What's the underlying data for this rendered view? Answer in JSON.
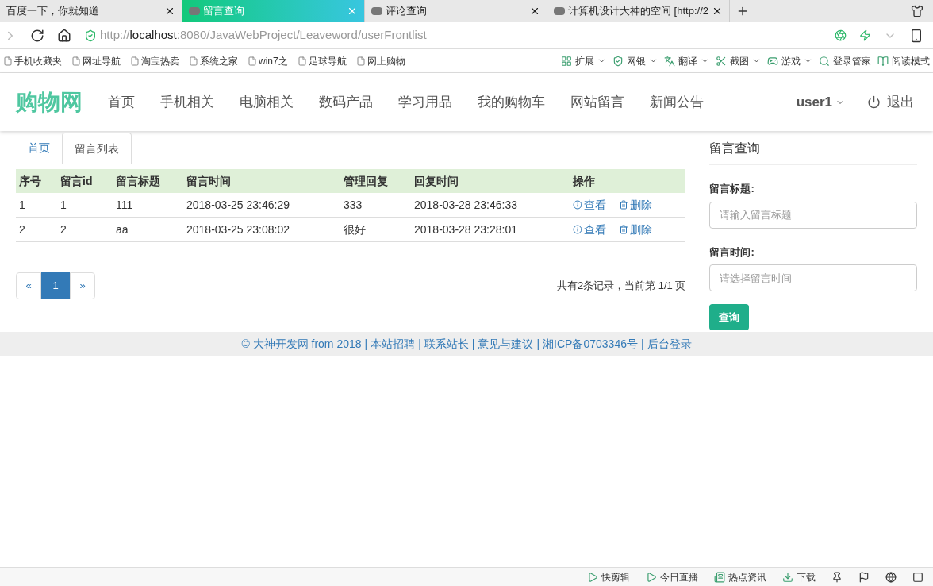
{
  "browser_tabs": [
    {
      "title": "百度一下，你就知道",
      "selected": false
    },
    {
      "title": "留言查询",
      "selected": true
    },
    {
      "title": "评论查询",
      "selected": false
    },
    {
      "title": "计算机设计大神的空间 [http://2",
      "selected": false
    }
  ],
  "address_bar": {
    "scheme": "http://",
    "host": "localhost",
    "path": ":8080/JavaWebProject/Leaveword/userFrontlist"
  },
  "bookmarks": [
    "手机收藏夹",
    "网址导航",
    "淘宝热卖",
    "系统之家",
    "win7之",
    "足球导航",
    "网上购物"
  ],
  "browser_tools": [
    {
      "label": "扩展",
      "dropdown": true
    },
    {
      "label": "网银",
      "dropdown": true
    },
    {
      "label": "翻译",
      "dropdown": true
    },
    {
      "label": "截图",
      "dropdown": true
    },
    {
      "label": "游戏",
      "dropdown": true
    },
    {
      "label": "登录管家",
      "dropdown": false
    },
    {
      "label": "阅读模式",
      "dropdown": false
    }
  ],
  "navbar": {
    "brand": "购物网",
    "links": [
      "首页",
      "手机相关",
      "电脑相关",
      "数码产品",
      "学习用品",
      "我的购物车",
      "网站留言",
      "新闻公告"
    ],
    "user": "user1",
    "logout": "退出"
  },
  "page_tabs": [
    {
      "label": "首页",
      "selected": false
    },
    {
      "label": "留言列表",
      "selected": true
    }
  ],
  "table": {
    "columns": [
      "序号",
      "留言id",
      "留言标题",
      "留言时间",
      "管理回复",
      "回复时间",
      "操作"
    ],
    "rows": [
      {
        "cells": [
          "1",
          "1",
          "111",
          "2018-03-25 23:46:29",
          "333",
          "2018-03-28 23:46:33"
        ],
        "actions": [
          {
            "kind": "view",
            "label": "查看"
          },
          {
            "kind": "delete",
            "label": "删除"
          }
        ]
      },
      {
        "cells": [
          "2",
          "2",
          "aa",
          "2018-03-25 23:08:02",
          "很好",
          "2018-03-28 23:28:01"
        ],
        "actions": [
          {
            "kind": "view",
            "label": "查看"
          },
          {
            "kind": "delete",
            "label": "删除"
          }
        ]
      }
    ]
  },
  "pagination": {
    "prev": "«",
    "pages": [
      {
        "label": "1",
        "selected": true
      }
    ],
    "next": "»",
    "summary": "共有2条记录，当前第 1/1 页"
  },
  "search_panel": {
    "title": "留言查询",
    "fields": [
      {
        "label": "留言标题:",
        "placeholder": "请输入留言标题"
      },
      {
        "label": "留言时间:",
        "placeholder": "请选择留言时间"
      }
    ],
    "button": "查询"
  },
  "footer": {
    "separator": "|",
    "items": [
      "© 大神开发网 from 2018",
      "本站招聘",
      "联系站长",
      "意见与建议",
      "湘ICP备0703346号",
      "后台登录"
    ]
  },
  "status_bar": [
    "快剪辑",
    "今日直播",
    "热点资讯",
    "下载"
  ]
}
